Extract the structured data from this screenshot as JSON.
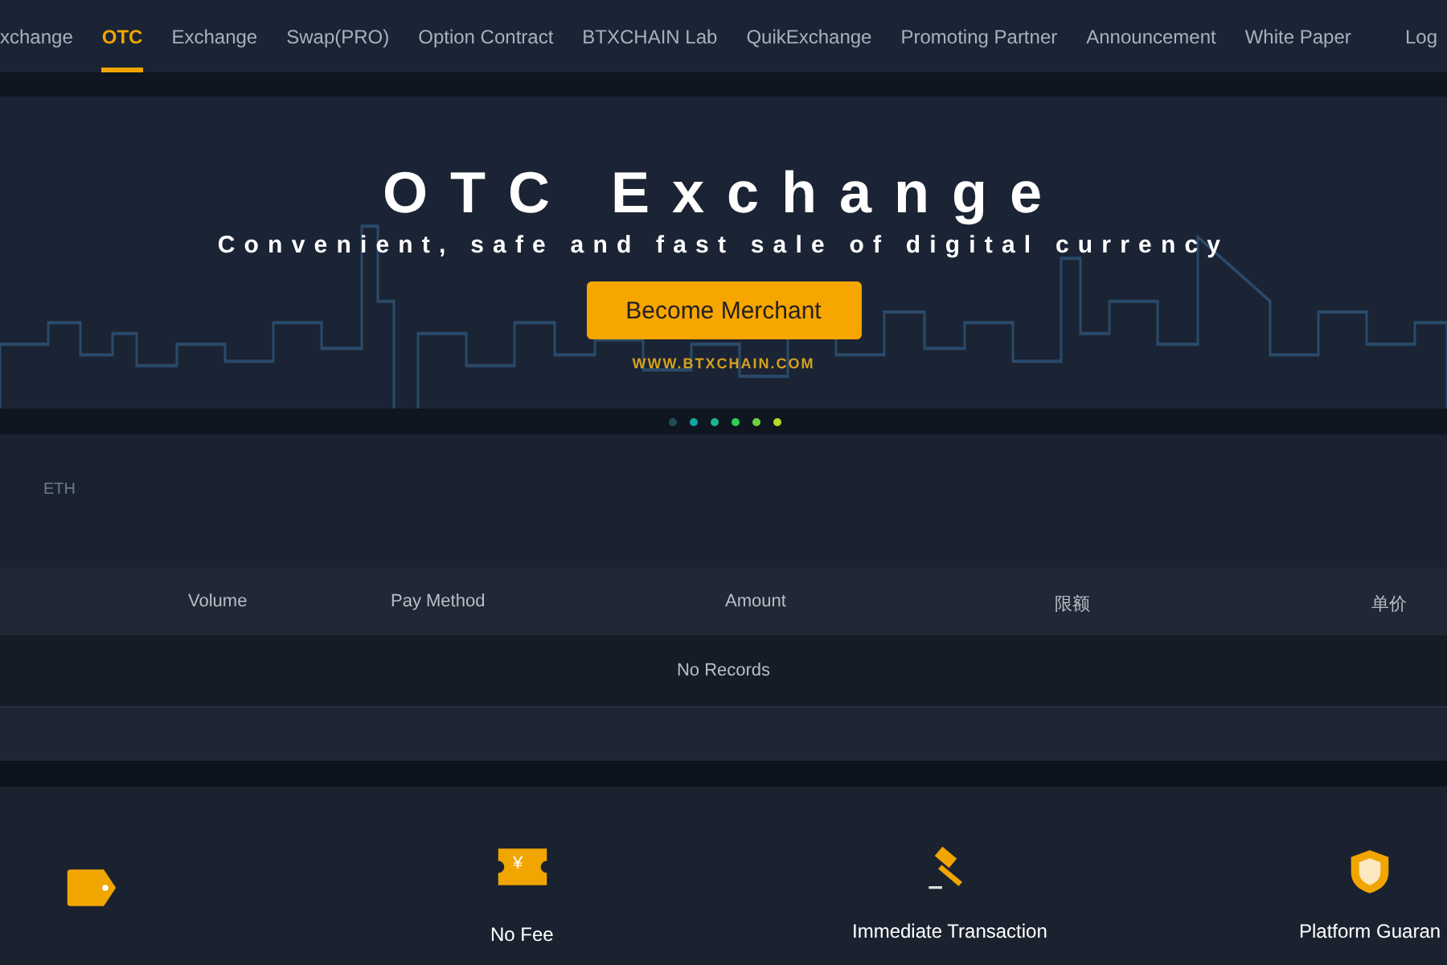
{
  "nav": {
    "items": [
      {
        "label": "xchange",
        "selected": false
      },
      {
        "label": "OTC",
        "selected": true
      },
      {
        "label": "Exchange",
        "selected": false
      },
      {
        "label": "Swap(PRO)",
        "selected": false
      },
      {
        "label": "Option Contract",
        "selected": false
      },
      {
        "label": "BTXCHAIN Lab",
        "selected": false
      },
      {
        "label": "QuikExchange",
        "selected": false
      },
      {
        "label": "Promoting Partner",
        "selected": false
      },
      {
        "label": "Announcement",
        "selected": false
      },
      {
        "label": "White Paper",
        "selected": false
      }
    ],
    "login": "Log"
  },
  "hero": {
    "title": "OTC Exchange",
    "subtitle": "Convenient, safe and fast sale of digital currency",
    "button": "Become Merchant",
    "site": "WWW.BTXCHAIN.COM",
    "dots": [
      {
        "color": "#1f4e5a"
      },
      {
        "color": "#15a3a3"
      },
      {
        "color": "#18b88a"
      },
      {
        "color": "#2ecc55"
      },
      {
        "color": "#6fd23a"
      },
      {
        "color": "#b8d82a"
      }
    ]
  },
  "coin_tab": "ETH",
  "table": {
    "columns": [
      "Volume",
      "Pay Method",
      "Amount",
      "限额",
      "单价"
    ],
    "empty": "No Records"
  },
  "features": [
    {
      "kind": "tag"
    },
    {
      "kind": "ticket",
      "symbol": "¥",
      "label": "No Fee"
    },
    {
      "kind": "gavel",
      "label": "Immediate Transaction"
    },
    {
      "kind": "shield",
      "label": "Platform Guaran"
    }
  ]
}
